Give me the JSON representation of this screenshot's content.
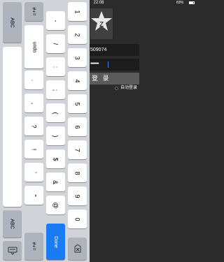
{
  "status": {
    "time": "22:08",
    "battery": "83%"
  },
  "login": {
    "account_value": "509074",
    "password_mask": "••••••••",
    "login_label": "登 录",
    "auto_login_label": "自动登录"
  },
  "keyboard": {
    "abc_label": "ABC",
    "numbers_switch_label": "#+=",
    "undo_label": "undo",
    "done_label": "Done",
    "digits": [
      "1",
      "2",
      "3",
      "4",
      "5",
      "6",
      "7",
      "8",
      "9",
      "0"
    ],
    "symbols": [
      "-",
      "/",
      ":",
      ";",
      "(",
      ")",
      "$",
      "&",
      "@"
    ],
    "punctuation": [
      ".",
      ",",
      "?",
      "!",
      "'",
      "\""
    ]
  },
  "colors": {
    "accent": "#1a7cf5",
    "app_bg": "#2b2b2b",
    "keyboard_bg": "#d0d3d8"
  }
}
